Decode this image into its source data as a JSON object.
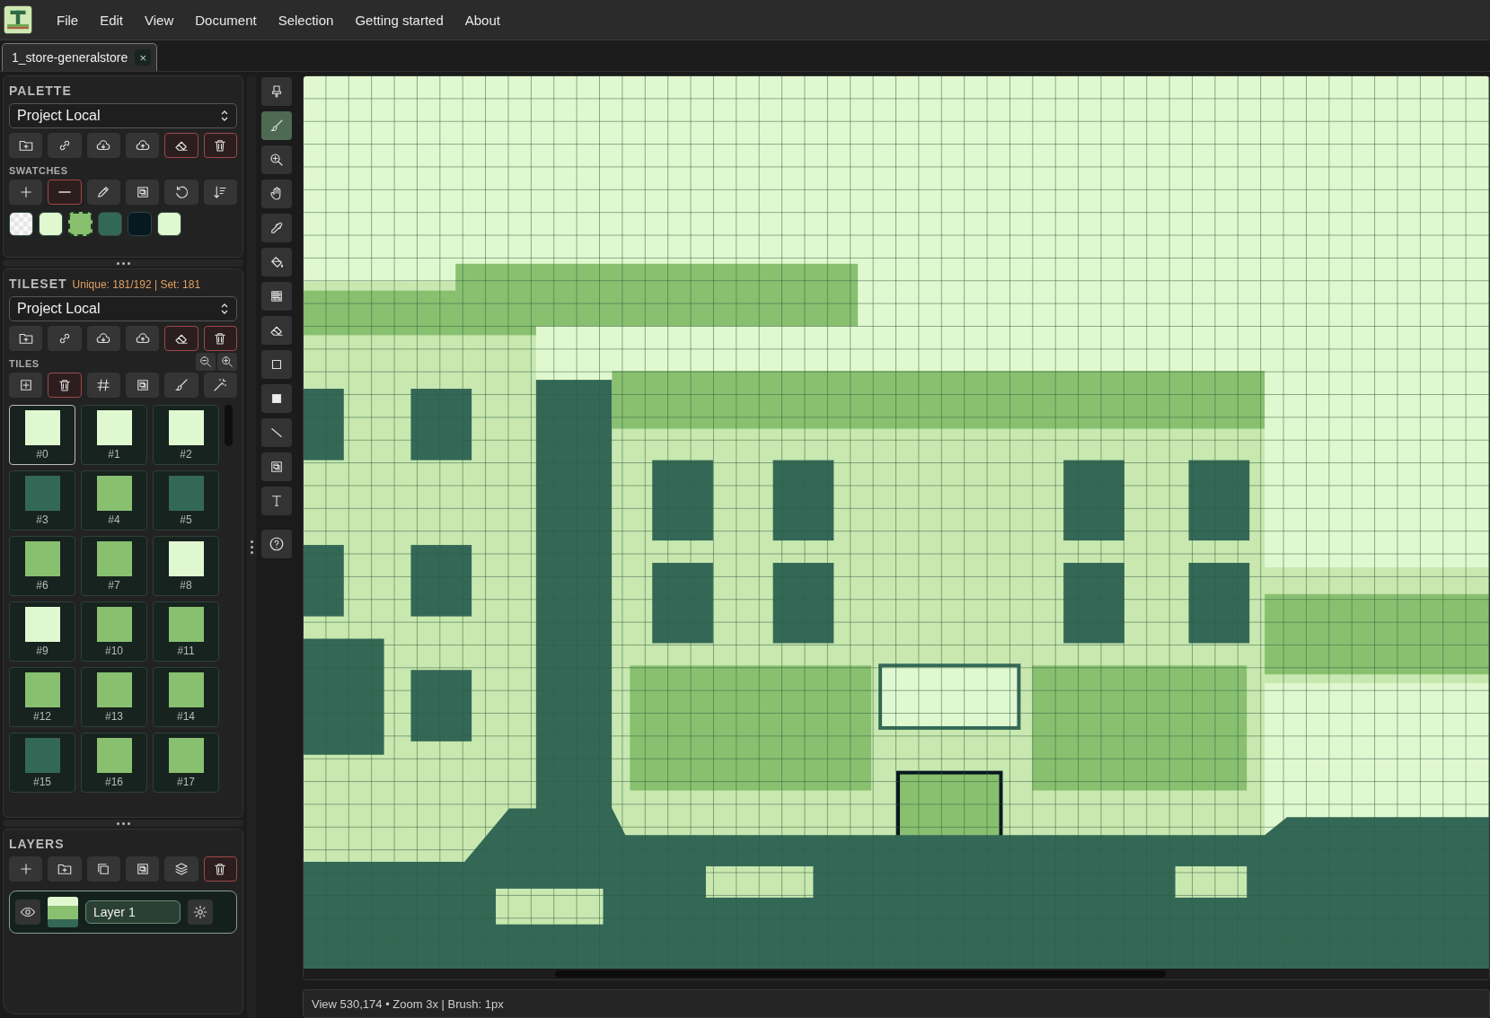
{
  "menu": [
    "File",
    "Edit",
    "View",
    "Document",
    "Selection",
    "Getting started",
    "About"
  ],
  "tabs": [
    {
      "label": "1_store-generalstore",
      "close": "×",
      "selected": true
    }
  ],
  "palette": {
    "title": "PALETTE",
    "source": "Project Local",
    "swatches_title": "SWATCHES",
    "swatches": [
      {
        "kind": "transparent",
        "selected": false
      },
      {
        "kind": "solid",
        "color": "#e0f8d0",
        "selected": false
      },
      {
        "kind": "solid",
        "color": "#88c070",
        "selected": true
      },
      {
        "kind": "solid",
        "color": "#346856",
        "selected": false
      },
      {
        "kind": "solid",
        "color": "#081820",
        "selected": false
      },
      {
        "kind": "solid",
        "color": "#e0f8d0",
        "selected": false
      }
    ]
  },
  "tileset": {
    "title": "TILESET",
    "info": "Unique: 181/192 | Set: 181",
    "source": "Project Local",
    "tiles_title": "TILES",
    "tiles": [
      {
        "label": "#0",
        "color": "#e0f8d0",
        "selected": true
      },
      {
        "label": "#1",
        "color": "#e0f8d0",
        "selected": false
      },
      {
        "label": "#2",
        "color": "#e0f8d0",
        "selected": false
      },
      {
        "label": "#3",
        "color": "#346856",
        "selected": false
      },
      {
        "label": "#4",
        "color": "#88c070",
        "selected": false
      },
      {
        "label": "#5",
        "color": "#346856",
        "selected": false
      },
      {
        "label": "#6",
        "color": "#88c070",
        "selected": false
      },
      {
        "label": "#7",
        "color": "#88c070",
        "selected": false
      },
      {
        "label": "#8",
        "color": "#e0f8d0",
        "selected": false
      },
      {
        "label": "#9",
        "color": "#e0f8d0",
        "selected": false
      },
      {
        "label": "#10",
        "color": "#88c070",
        "selected": false
      },
      {
        "label": "#11",
        "color": "#88c070",
        "selected": false
      },
      {
        "label": "#12",
        "color": "#88c070",
        "selected": false
      },
      {
        "label": "#13",
        "color": "#88c070",
        "selected": false
      },
      {
        "label": "#14",
        "color": "#88c070",
        "selected": false
      },
      {
        "label": "#15",
        "color": "#346856",
        "selected": false
      },
      {
        "label": "#16",
        "color": "#88c070",
        "selected": false
      },
      {
        "label": "#17",
        "color": "#88c070",
        "selected": false
      }
    ]
  },
  "layers": {
    "title": "LAYERS",
    "items": [
      {
        "name": "Layer 1",
        "visible": true
      }
    ]
  },
  "tools": [
    {
      "selected": false
    },
    {
      "selected": true
    },
    {
      "selected": false
    },
    {
      "selected": false
    },
    {
      "selected": false
    },
    {
      "selected": false
    },
    {
      "selected": false
    },
    {
      "selected": false
    },
    {
      "selected": false
    },
    {
      "selected": false
    },
    {
      "selected": false
    },
    {
      "selected": false
    },
    {
      "selected": false
    },
    {
      "selected": false
    }
  ],
  "status_bar": "View 530,174 • Zoom 3x | Brush: 1px"
}
